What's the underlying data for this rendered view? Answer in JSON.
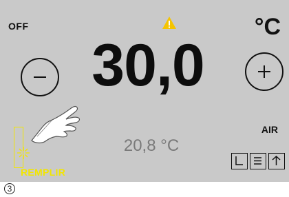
{
  "display": {
    "status": "OFF",
    "unit": "°C",
    "setpoint": "30,0",
    "current_temperature": "20,8 °C",
    "mode": "AIR",
    "fill_label": "REMPLIR"
  },
  "icons": {
    "warning": "warning-icon",
    "minus": "minus-icon",
    "plus": "plus-icon",
    "timer": "timer-icon",
    "menu": "menu-icon",
    "up": "up-arrow-icon",
    "hand": "pointing-hand-icon",
    "fill": "fill-level-icon"
  },
  "callout": "3",
  "colors": {
    "panel": "#c9c9c9",
    "text": "#111111",
    "secondary_text": "#7a7a7a",
    "warning": "#f5c400",
    "fill": "#f2e600"
  }
}
